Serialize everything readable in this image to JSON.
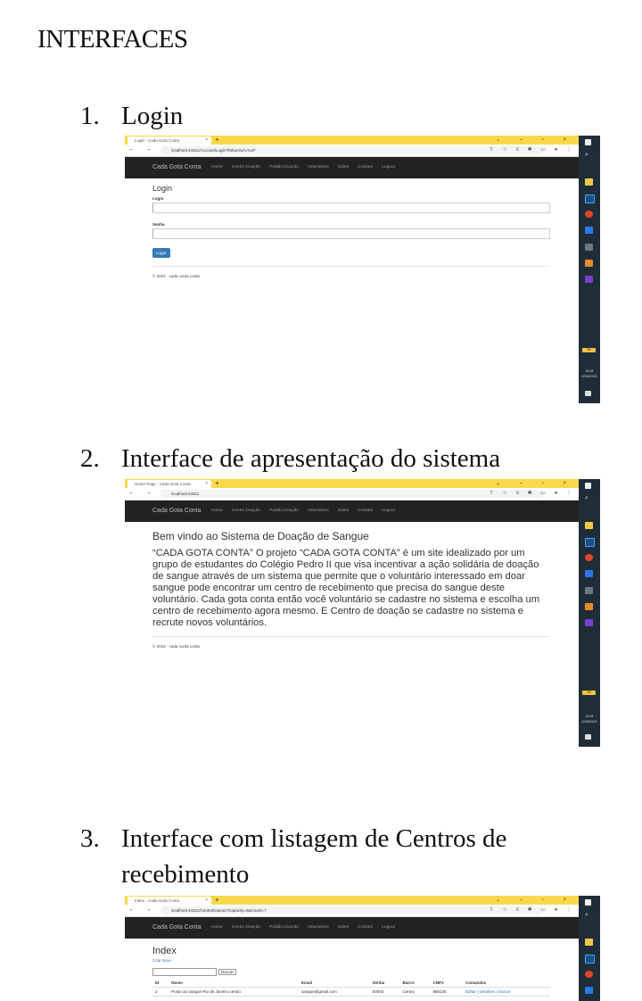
{
  "doc": {
    "title": "INTERFACES",
    "items": [
      {
        "num": "1.",
        "label": "Login"
      },
      {
        "num": "2.",
        "label": "Interface de apresentação do sistema"
      },
      {
        "num": "3.",
        "label": "Interface com listagem de Centros de recebimento"
      }
    ]
  },
  "browser": {
    "brand": "Cada Gota Conta",
    "nav": [
      "Home",
      "Centro Doação",
      "Pedido Doação",
      "Voluntários",
      "Sobre",
      "Contato",
      "Logout"
    ],
    "footer": "© 2022 - cada conta conta",
    "new_tab": "+",
    "tab_close": "×",
    "win_controls": "⌄ – ▫ ×",
    "nav_arrows": "← → C",
    "addr_icons": "⇧ ☆ ≡ ✱ ▭ ● ⋮"
  },
  "shot1": {
    "tab_title": "Login - Cada Gota Conta",
    "url": "localhost:44311/Account/Login?ReturnUrl=%2F",
    "heading": "Login",
    "login_label": "Login",
    "senha_label": "Senha",
    "button": "Logar",
    "clock_time": "15:15",
    "clock_date": "02/08/2022",
    "badge": "3%"
  },
  "shot2": {
    "tab_title": "Home Page - Cada Gota Conta",
    "url": "localhost:44311",
    "heading": "Bem vindo ao Sistema de Doação de Sangue",
    "paragraph": "“CADA GOTA CONTA” O projeto “CADA GOTA CONTA” é um site idealizado por um grupo de estudantes do Colégio Pedro II que visa incentivar a ação solidária de doação de sangue através de um sistema que permite que o voluntário interessado em doar sangue pode encontrar um centro de recebimento que precisa do sangue deste voluntário. Cada gota conta então você voluntário se cadastre no sistema e escolha um centro de recebimento agora mesmo. E Centro de doação se cadastre no sistema e recrute novos voluntários.",
    "clock_time": "15:34",
    "clock_date": "02/08/2022",
    "badge": "2%"
  },
  "shot3": {
    "tab_title": "Index - Cada Gota Conta",
    "url": "localhost:44311/CentroDoacao?Capacity=6&Count=7",
    "heading": "Index",
    "create_link": "Criar Novo",
    "search_button": "Buscar",
    "columns": [
      "ID",
      "Nome",
      "Email",
      "Senha",
      "Bairro",
      "CNPJ",
      "Comandos"
    ],
    "rows": [
      [
        "2",
        "Posto do sangue Rio de Janeiro centro",
        "sangue@gmail.com",
        "00000",
        "Centro",
        "888135",
        "Editar | Detalhes | Excluir"
      ]
    ]
  },
  "colors": {
    "tab_bar": "#f9d94a",
    "app_nav": "#222222",
    "taskbar": "#1f2d38",
    "button_primary": "#337ab7"
  }
}
